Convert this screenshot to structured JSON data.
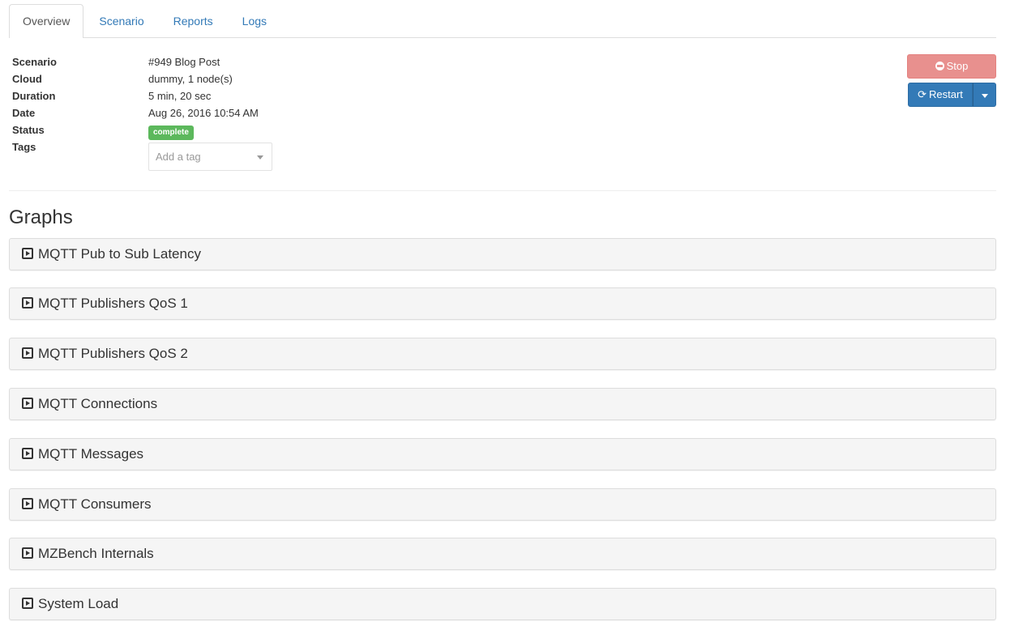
{
  "tabs": [
    {
      "label": "Overview",
      "active": true
    },
    {
      "label": "Scenario",
      "active": false
    },
    {
      "label": "Reports",
      "active": false
    },
    {
      "label": "Logs",
      "active": false
    }
  ],
  "info": {
    "scenario_label": "Scenario",
    "scenario_value": "#949 Blog Post",
    "cloud_label": "Cloud",
    "cloud_value": "dummy, 1 node(s)",
    "duration_label": "Duration",
    "duration_value": "5 min, 20 sec",
    "date_label": "Date",
    "date_value": "Aug 26, 2016 10:54 AM",
    "status_label": "Status",
    "status_value": "complete",
    "tags_label": "Tags",
    "tags_placeholder": "Add a tag"
  },
  "actions": {
    "stop_label": "Stop",
    "restart_label": "Restart"
  },
  "colors": {
    "status_complete": "#5cb85c",
    "stop_button": "#e8908e",
    "restart_button": "#337ab7",
    "link": "#337ab7"
  },
  "graphs": {
    "title": "Graphs",
    "panels": [
      {
        "title": "MQTT Pub to Sub Latency"
      },
      {
        "title": "MQTT Publishers QoS 1"
      },
      {
        "title": "MQTT Publishers QoS 2"
      },
      {
        "title": "MQTT Connections"
      },
      {
        "title": "MQTT Messages"
      },
      {
        "title": "MQTT Consumers"
      },
      {
        "title": "MZBench Internals"
      },
      {
        "title": "System Load"
      }
    ]
  }
}
